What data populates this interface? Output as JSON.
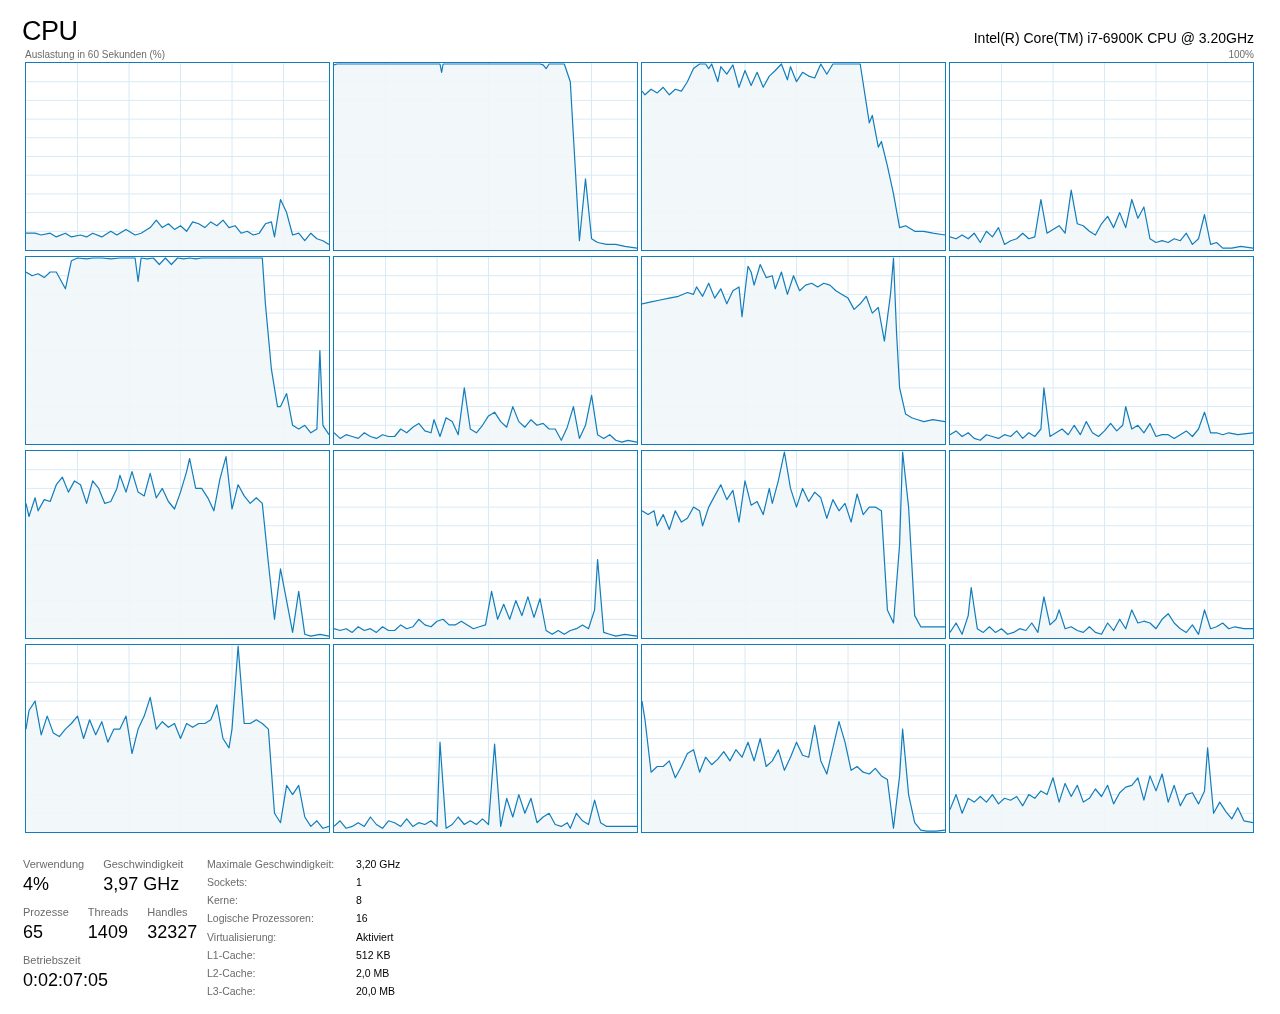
{
  "title": "CPU",
  "processor_name": "Intel(R) Core(TM) i7-6900K CPU @ 3.20GHz",
  "graph_caption": "Auslastung in 60 Sekunden (%)",
  "graph_max": "100%",
  "stats": [
    [
      {
        "label": "Verwendung",
        "value": "4%"
      },
      {
        "label": "Geschwindigkeit",
        "value": "3,97 GHz"
      }
    ],
    [
      {
        "label": "Prozesse",
        "value": "65"
      },
      {
        "label": "Threads",
        "value": "1409"
      },
      {
        "label": "Handles",
        "value": "32327"
      }
    ],
    [
      {
        "label": "Betriebszeit",
        "value": "0:02:07:05"
      }
    ]
  ],
  "details": [
    {
      "label": "Maximale Geschwindigkeit:",
      "value": "3,20 GHz"
    },
    {
      "label": "Sockets:",
      "value": "1"
    },
    {
      "label": "Kerne:",
      "value": "8"
    },
    {
      "label": "Logische Prozessoren:",
      "value": "16"
    },
    {
      "label": "Virtualisierung:",
      "value": "Aktiviert"
    },
    {
      "label": "L1-Cache:",
      "value": "512 KB"
    },
    {
      "label": "L2-Cache:",
      "value": "2,0 MB"
    },
    {
      "label": "L3-Cache:",
      "value": "20,0 MB"
    }
  ]
}
